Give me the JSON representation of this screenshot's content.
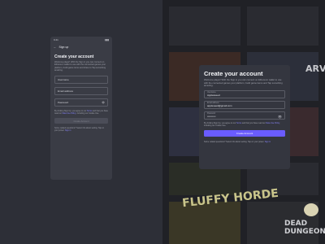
{
  "mobile": {
    "status": {
      "time": "9:41",
      "icons": "▮▮▮"
    },
    "header": {
      "back_icon": "←",
      "title": "Sign up"
    },
    "title": "Create your account",
    "intro": "Welcome player! With the Sign in you can connect on Ethereum wallet to use with the connected games your platform, build game items and share to Tap something amazing.",
    "fields": {
      "username": "Username",
      "email": "Email address",
      "password": "Password",
      "eye_icon": "👁"
    },
    "terms": {
      "prefix": "By clicking Sign Up, you agree to our ",
      "link1": "Terms",
      "mid": " and that you have read our ",
      "link2": "Data Use Policy",
      "suffix": ", including our Cookie Use."
    },
    "create_label": "Create Account",
    "footer": {
      "prefix": "Some related questions? Select info about setting. Tap on your power. ",
      "link": "Sign in"
    }
  },
  "modal": {
    "title": "Create your account",
    "intro": "Welcome player! With the Sign in you can connect on Ethereum wallet to use with the connected games your platform, build game items and Tap something amazing.",
    "username": {
      "label": "Username",
      "value": "Applesseed"
    },
    "email": {
      "label": "Email address",
      "value": "appleseed@gmail.com"
    },
    "password": {
      "label": "Password",
      "value": "••••••••••",
      "eye_icon": "👁"
    },
    "terms": {
      "prefix": "By clicking Sign Up, you agree to our ",
      "link1": "Terms",
      "mid": " and that you have read our ",
      "link2": "Data Use Policy",
      "suffix": ", including our Cookie Use."
    },
    "create_label": "Create Account",
    "footer": {
      "prefix": "Some related questions? Select info about setting. Tap on your power. ",
      "link": "Sign in"
    }
  },
  "background": {
    "tile_text_1": "FLUFFY HORDE",
    "tile_text_2": "DEAD DUNGEON",
    "tile_text_3": "ARVO"
  },
  "colors": {
    "accent": "#6a5cff",
    "link": "#8a86ff"
  }
}
